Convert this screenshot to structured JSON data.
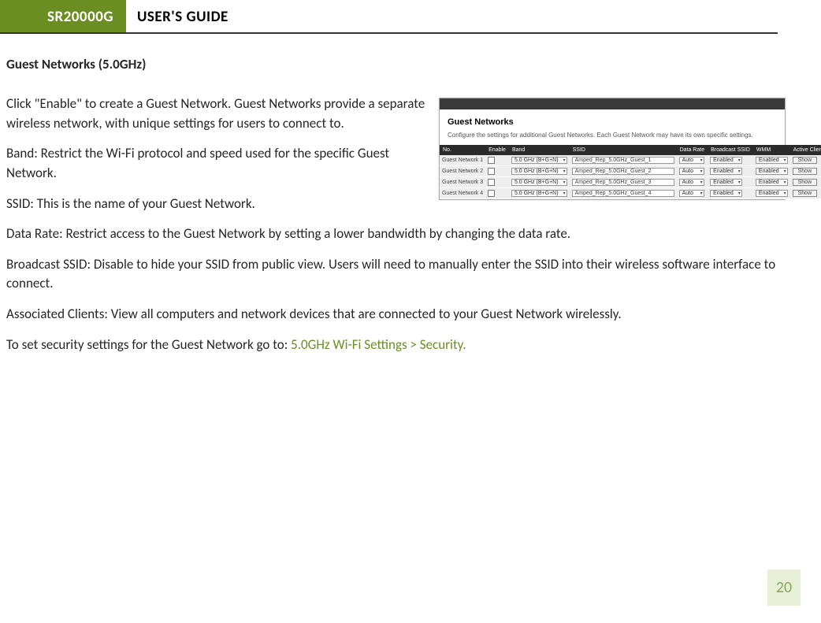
{
  "header": {
    "model": "SR20000G",
    "title": "USER'S GUIDE"
  },
  "section_heading": "Guest Networks (5.0GHz)",
  "paragraphs": {
    "p1": "Click \"Enable\" to create a Guest Network. Guest Networks provide a separate wireless network, with unique settings for users to connect to.",
    "p2": "Band: Restrict the Wi-Fi protocol and speed used for the specific Guest Network.",
    "p3": "SSID: This is the name of your Guest Network.",
    "p4": "Data Rate: Restrict access to the Guest Network by setting a lower bandwidth by changing the data rate.",
    "p5": "Broadcast SSID: Disable to hide your SSID from public view. Users will need to manually enter the SSID into their wireless software interface to connect.",
    "p6": "Associated Clients: View all computers and network devices that are connected to your Guest Network wirelessly.",
    "p7_prefix": "To set security settings for the Guest Network go to: ",
    "p7_link": "5.0GHz Wi-Fi Settings > Security."
  },
  "screenshot": {
    "title": "Guest Networks",
    "desc": "Configure the settings for additional Guest Networks. Each Guest Network may have its own specific settings.",
    "headers": {
      "no": "No.",
      "enable": "Enable",
      "band": "Band",
      "ssid": "SSID",
      "data_rate": "Data Rate",
      "broadcast": "Broadcast SSID",
      "wmm": "WMM",
      "active": "Active Client List"
    },
    "rows": [
      {
        "no": "Guest Network 1",
        "band": "5.0 GHz (B+G+N)",
        "ssid": "Amped_Rep_5.0GHz_Guest_1",
        "rate": "Auto",
        "broadcast": "Enabled",
        "wmm": "Enabled",
        "btn": "Show"
      },
      {
        "no": "Guest Network 2",
        "band": "5.0 GHz (B+G+N)",
        "ssid": "Amped_Rep_5.0GHz_Guest_2",
        "rate": "Auto",
        "broadcast": "Enabled",
        "wmm": "Enabled",
        "btn": "Show"
      },
      {
        "no": "Guest Network 3",
        "band": "5.0 GHz (B+G+N)",
        "ssid": "Amped_Rep_5.0GHz_Guest_3",
        "rate": "Auto",
        "broadcast": "Enabled",
        "wmm": "Enabled",
        "btn": "Show"
      },
      {
        "no": "Guest Network 4",
        "band": "5.0 GHz (B+G+N)",
        "ssid": "Amped_Rep_5.0GHz_Guest_4",
        "rate": "Auto",
        "broadcast": "Enabled",
        "wmm": "Enabled",
        "btn": "Show"
      }
    ]
  },
  "page_number": "20"
}
